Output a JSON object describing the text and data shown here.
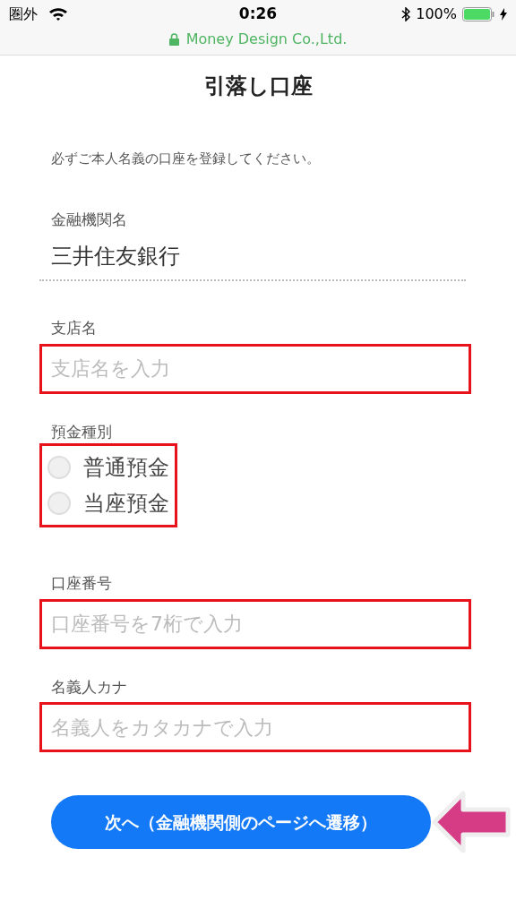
{
  "status_bar": {
    "carrier": "圏外",
    "time": "0:26",
    "battery": "100%",
    "site": "Money Design Co.,Ltd."
  },
  "title": "引落し口座",
  "notice": "必ずご本人名義の口座を登録してください。",
  "fields": [
    {
      "kind": "static",
      "label": "金融機関名",
      "value": "三井住友銀行"
    },
    {
      "kind": "text",
      "label": "支店名",
      "placeholder": "支店名を入力",
      "highlighted": true
    },
    {
      "kind": "radio",
      "label": "預金種別",
      "highlighted": true,
      "options": [
        {
          "label": "普通預金",
          "selected": false
        },
        {
          "label": "当座預金",
          "selected": false
        }
      ]
    },
    {
      "kind": "text",
      "label": "口座番号",
      "placeholder": "口座番号を7桁で入力",
      "highlighted": true
    },
    {
      "kind": "text",
      "label": "名義人カナ",
      "placeholder": "名義人をカタカナで入力",
      "highlighted": true
    }
  ],
  "next_button": {
    "label": "次へ（金融機関側のページへ遷移）",
    "pointed_at": true
  }
}
